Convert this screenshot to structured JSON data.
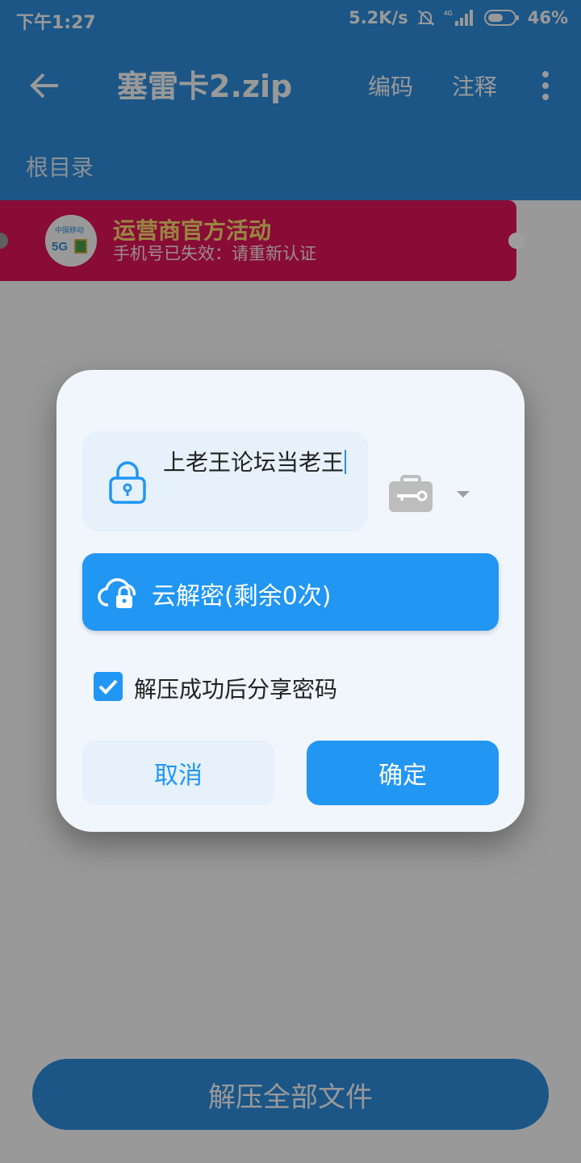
{
  "status_bar": {
    "time": "下午1:27",
    "net_speed": "5.2K/s",
    "network_type": "4G",
    "battery": "46%"
  },
  "toolbar": {
    "title": "塞雷卡2.zip",
    "encoding_label": "编码",
    "comment_label": "注释"
  },
  "breadcrumb": "根目录",
  "banner": {
    "title": "运营商官方活动",
    "subtitle": "手机号已失效：请重新认证"
  },
  "dialog": {
    "password_value": "上老王论坛当老王",
    "cloud_decrypt_label": "云解密(剩余0次)",
    "share_checkbox_label": "解压成功后分享密码",
    "share_checked": true,
    "cancel_label": "取消",
    "ok_label": "确定"
  },
  "extract_all_label": "解压全部文件",
  "colors": {
    "primary": "#2196f3",
    "appbar": "#2d8fe0",
    "banner": "#e5155a"
  }
}
